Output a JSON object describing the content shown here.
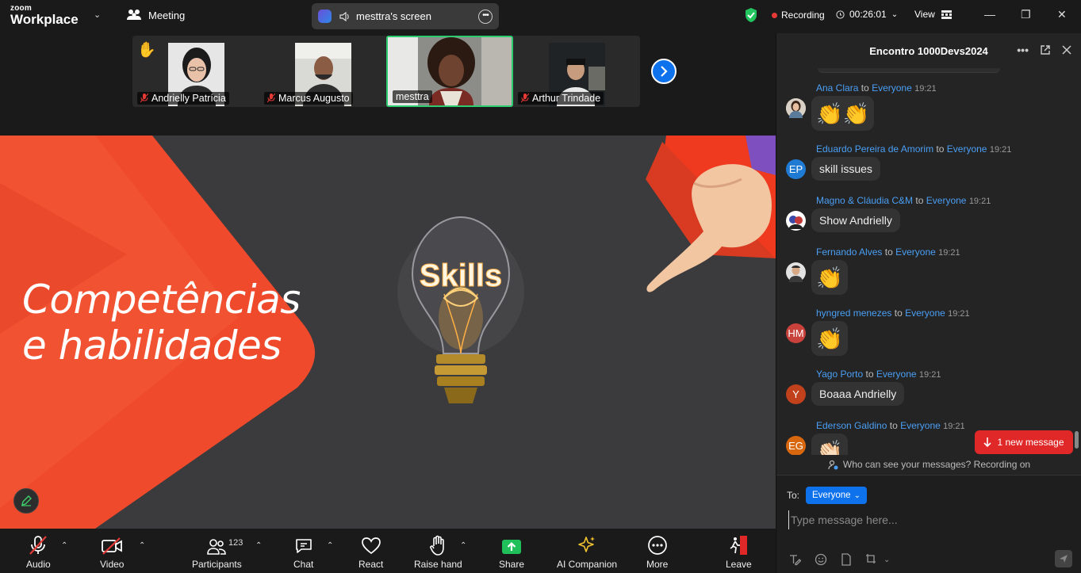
{
  "app": {
    "logo_line1": "zoom",
    "logo_line2": "Workplace"
  },
  "topbar": {
    "meeting_label": "Meeting",
    "share_label": "mesttra's screen",
    "recording_label": "Recording",
    "timer": "00:26:01",
    "view_label": "View"
  },
  "participants": [
    {
      "name": "Andrielly Patrícia",
      "muted": true,
      "hand_raised": true
    },
    {
      "name": "Marcus Augusto",
      "muted": true
    },
    {
      "name": "mesttra",
      "muted": false,
      "active_speaker": true
    },
    {
      "name": "Arthur Trindade",
      "muted": true
    }
  ],
  "slide": {
    "title_line1": "Competências",
    "title_line2": "e habilidades",
    "bulb_text": "Skills"
  },
  "toolbar": {
    "audio": "Audio",
    "video": "Video",
    "participants": "Participants",
    "participants_count": "123",
    "chat": "Chat",
    "react": "React",
    "raise_hand": "Raise hand",
    "share": "Share",
    "ai_companion": "AI Companion",
    "more": "More",
    "leave": "Leave"
  },
  "chat": {
    "title": "Encontro 1000Devs2024",
    "messages": [
      {
        "sender": "Ana Clara",
        "to": "to",
        "recipient": "Everyone",
        "time": "19:21",
        "initials": "",
        "text": "👏👏",
        "emoji": true
      },
      {
        "sender": "Eduardo Pereira de Amorim",
        "to": "to",
        "recipient": "Everyone",
        "time": "19:21",
        "initials": "EP",
        "text": "skill issues"
      },
      {
        "sender": "Magno & Cláudia C&M",
        "to": "to",
        "recipient": "Everyone",
        "time": "19:21",
        "initials": "",
        "text": "Show Andrielly"
      },
      {
        "sender": "Fernando Alves",
        "to": "to",
        "recipient": "Everyone",
        "time": "19:21",
        "initials": "",
        "text": "👏",
        "emoji": true
      },
      {
        "sender": "hyngred menezes",
        "to": "to",
        "recipient": "Everyone",
        "time": "19:21",
        "initials": "HM",
        "text": "👏",
        "emoji": true
      },
      {
        "sender": "Yago Porto",
        "to": "to",
        "recipient": "Everyone",
        "time": "19:21",
        "initials": "Y",
        "text": "Boaaa Andrielly"
      },
      {
        "sender": "Ederson Galdino",
        "to": "to",
        "recipient": "Everyone",
        "time": "19:21",
        "initials": "EG",
        "text": "👏🏻",
        "emoji": true
      }
    ],
    "new_message_label": "1 new message",
    "privacy_note": "Who can see your messages? Recording on",
    "to_label": "To:",
    "recipient_select": "Everyone",
    "input_placeholder": "Type message here..."
  },
  "colors": {
    "accent": "#0e72ed",
    "recording": "#e53935",
    "slide_red": "#f04a2c",
    "share_green": "#1fbf5a",
    "leave_red": "#e02828"
  }
}
